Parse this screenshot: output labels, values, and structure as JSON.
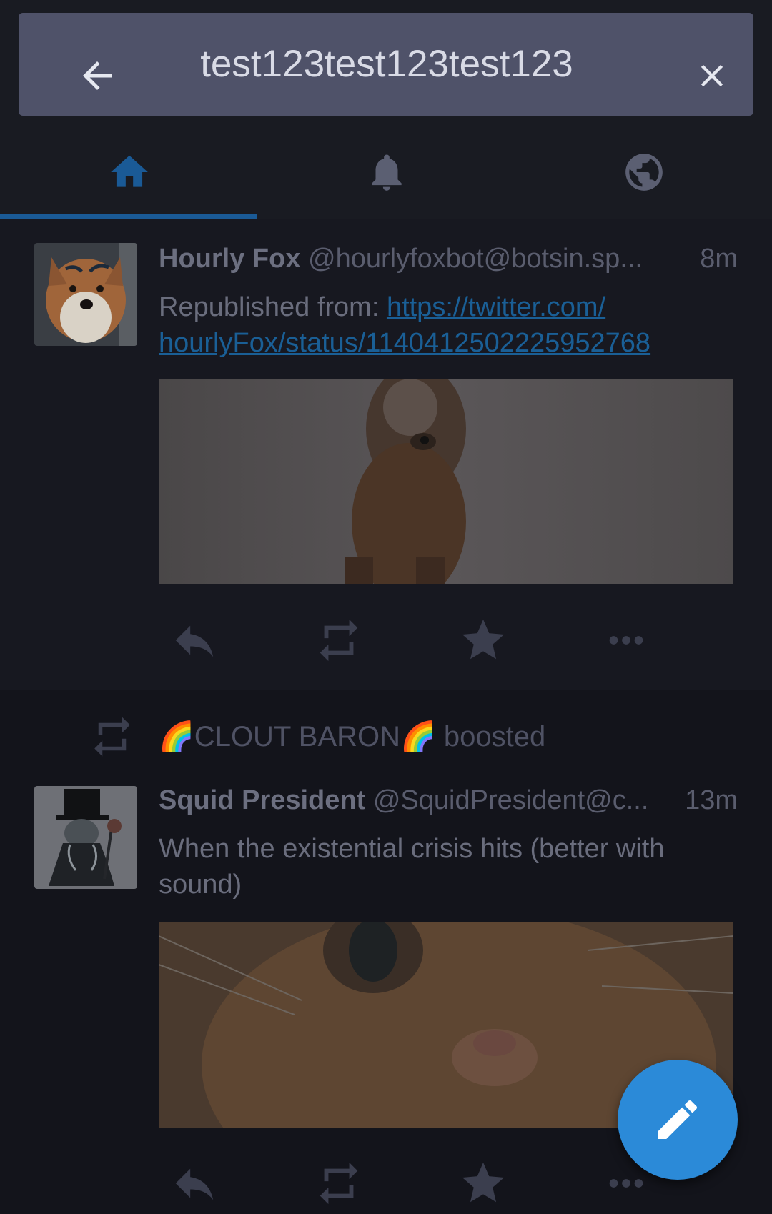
{
  "search": {
    "query": "test123test123test123"
  },
  "tabs": [
    {
      "name": "home",
      "icon": "home-icon",
      "active": true
    },
    {
      "name": "notifications",
      "icon": "bell-icon",
      "active": false
    },
    {
      "name": "federated",
      "icon": "globe-icon",
      "active": false
    }
  ],
  "statuses": [
    {
      "display_name": "Hourly Fox",
      "account": "@hourlyfoxbot@botsin.sp...",
      "time": "8m",
      "content_prefix": "Republished from: ",
      "link_line1": "https://twitter.com/",
      "link_line2": "hourlyFox/status/1140412502225952768"
    },
    {
      "boost_label": "🌈CLOUT BARON🌈 boosted",
      "display_name": "Squid President",
      "account": "@SquidPresident@c...",
      "time": "13m",
      "content": "When the existential crisis hits (better with sound)"
    }
  ],
  "colors": {
    "background": "#13141b",
    "search_bar": "#4f5269",
    "accent": "#2b8ad8",
    "link": "#1a5f96"
  }
}
